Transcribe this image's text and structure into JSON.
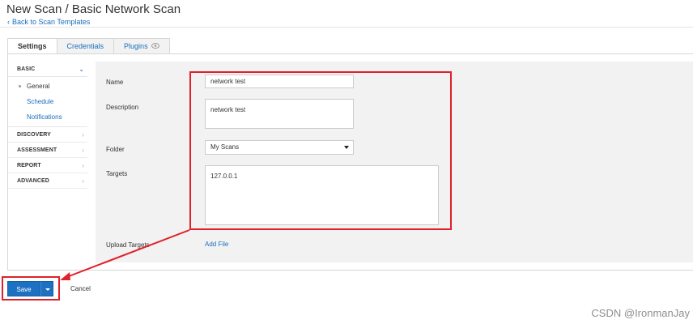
{
  "header": {
    "title": "New Scan / Basic Network Scan",
    "back_link": "Back to Scan Templates",
    "back_icon": "chevron-left-icon"
  },
  "tabs": [
    {
      "label": "Settings",
      "active": true
    },
    {
      "label": "Credentials",
      "active": false
    },
    {
      "label": "Plugins",
      "active": false,
      "icon": "eye-icon"
    }
  ],
  "sidebar": {
    "sections": [
      {
        "label": "BASIC",
        "expanded": true,
        "items": [
          {
            "label": "General",
            "current": true
          },
          {
            "label": "Schedule",
            "current": false
          },
          {
            "label": "Notifications",
            "current": false
          }
        ]
      },
      {
        "label": "DISCOVERY",
        "expanded": false
      },
      {
        "label": "ASSESSMENT",
        "expanded": false
      },
      {
        "label": "REPORT",
        "expanded": false
      },
      {
        "label": "ADVANCED",
        "expanded": false
      }
    ]
  },
  "form": {
    "name_label": "Name",
    "name_value": "network test",
    "description_label": "Description",
    "description_value": "network test",
    "folder_label": "Folder",
    "folder_value": "My Scans",
    "targets_label": "Targets",
    "targets_value": "127.0.0.1",
    "upload_label": "Upload Targets",
    "add_file": "Add File"
  },
  "footer": {
    "save_label": "Save",
    "cancel_label": "Cancel"
  },
  "annotation_color": "#e0202a",
  "accent_color": "#1d71c2",
  "watermark": "CSDN @IronmanJay"
}
